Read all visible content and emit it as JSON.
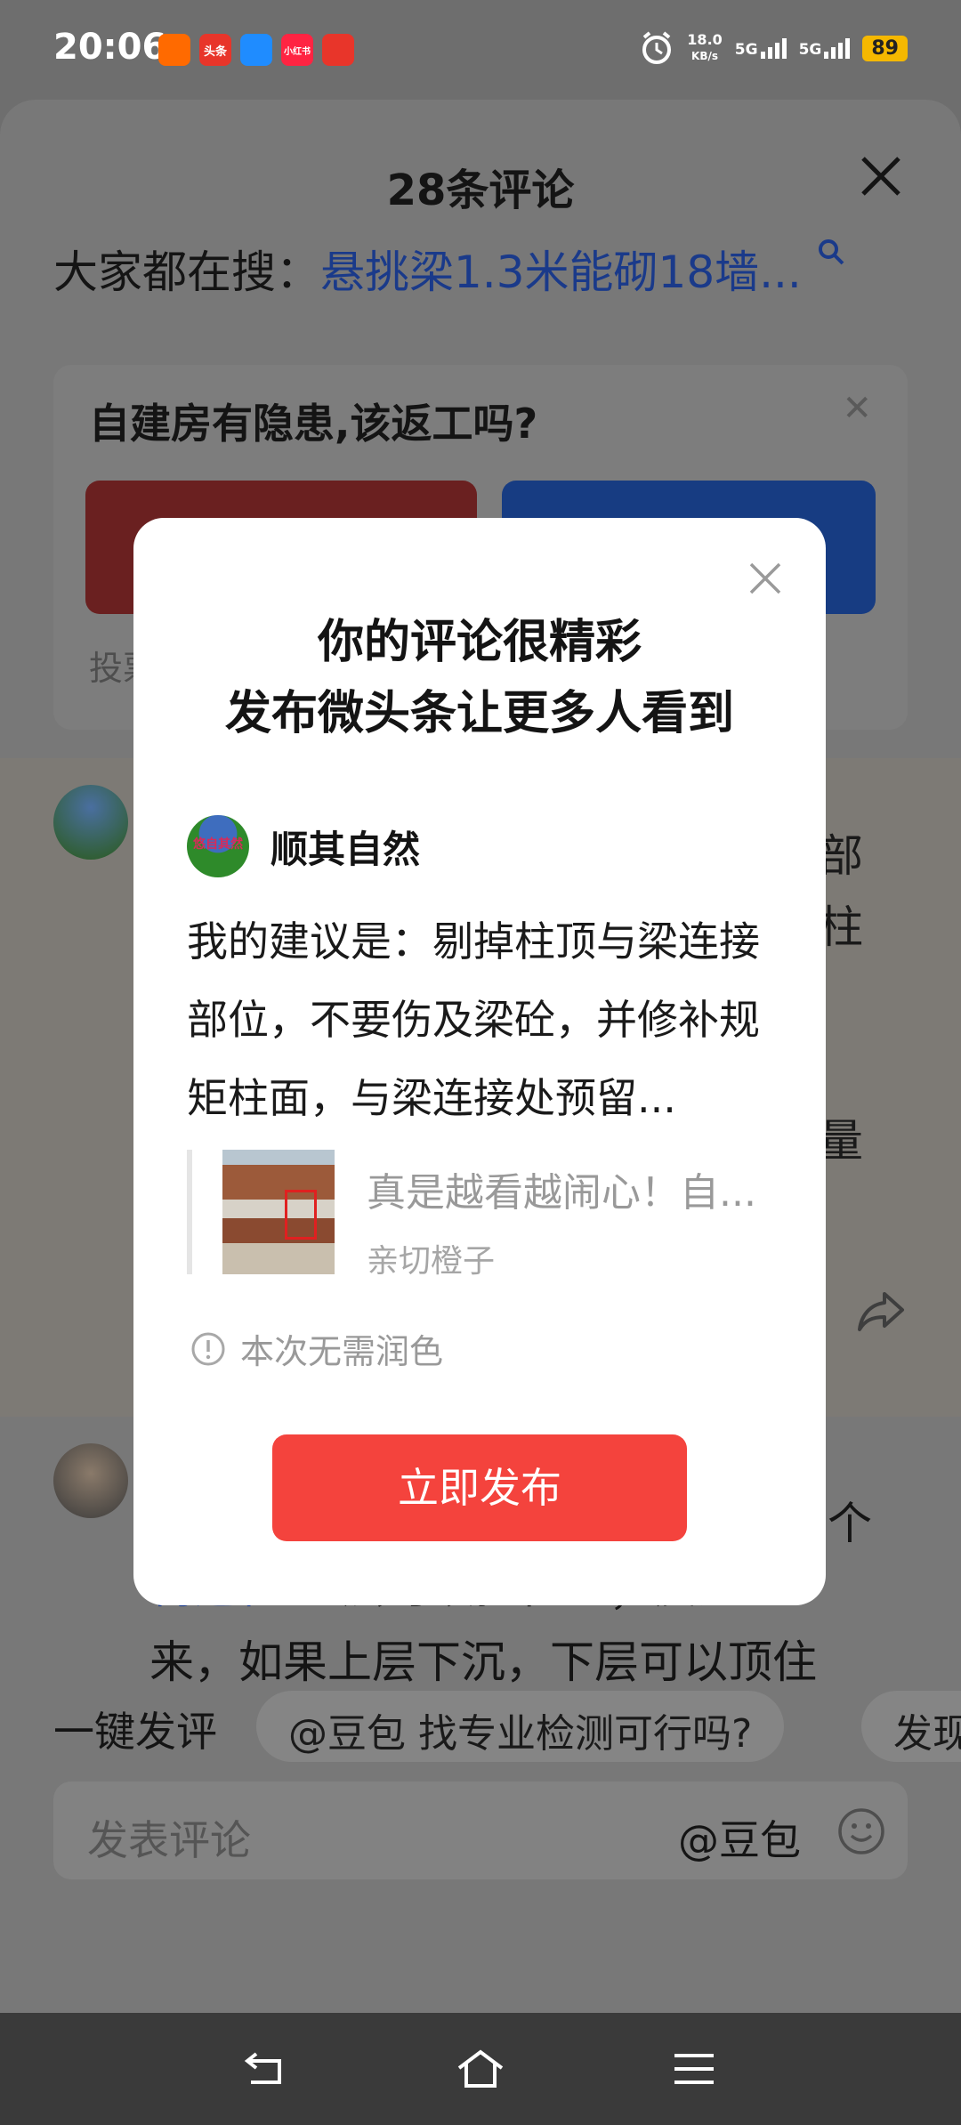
{
  "status_bar": {
    "time": "20:06",
    "apps": [
      {
        "icon": "kuaikan-app-icon",
        "label": "",
        "color": "#ff6a00"
      },
      {
        "icon": "toutiao-app-icon",
        "label": "头条",
        "color": "#e8352a"
      },
      {
        "icon": "blue-app-icon",
        "label": "",
        "color": "#1f8cff"
      },
      {
        "icon": "xiaohongshu-app-icon",
        "label": "小红书",
        "color": "#ff2442"
      },
      {
        "icon": "red-app-icon",
        "label": "",
        "color": "#e8352a"
      }
    ],
    "net_speed": "18.0",
    "net_unit": "KB/s",
    "signal1": "5G",
    "signal2": "5G",
    "battery": "89"
  },
  "sheet": {
    "title": "28条评论",
    "search_prefix": "大家都在搜：",
    "search_link": "悬挑梁1.3米能砌18墙...",
    "poll": {
      "question": "自建房有隐患,该返工吗?",
      "footer": "投票"
    },
    "comment1_right_text": [
      "部",
      "柱",
      "",
      "",
      "量"
    ],
    "comment2": {
      "right_text": "个",
      "link": "构造柱",
      "line1_rest": " 上层可以拉住它；反过",
      "line2": "来，如果上层下沉，下层可以顶住"
    },
    "quick_label": "一键发评",
    "chips": [
      "@豆包 找专业检测可行吗?",
      "发现"
    ],
    "input_placeholder": "发表评论",
    "input_at": "@豆包"
  },
  "modal": {
    "title_line1": "你的评论很精彩",
    "title_line2": "发布微头条让更多人看到",
    "author_name": "顺其自然",
    "avatar_text": "悠自其然",
    "comment": "我的建议是：剔掉柱顶与梁连接部位，不要伤及梁砼，并修补规矩柱面，与梁连接处预留...",
    "quote_title": "真是越看越闹心！自...",
    "quote_author": "亲切橙子",
    "note": "本次无需润色",
    "publish_label": "立即发布"
  },
  "colors": {
    "accent": "#f4433d",
    "link": "#1a3a8a"
  }
}
